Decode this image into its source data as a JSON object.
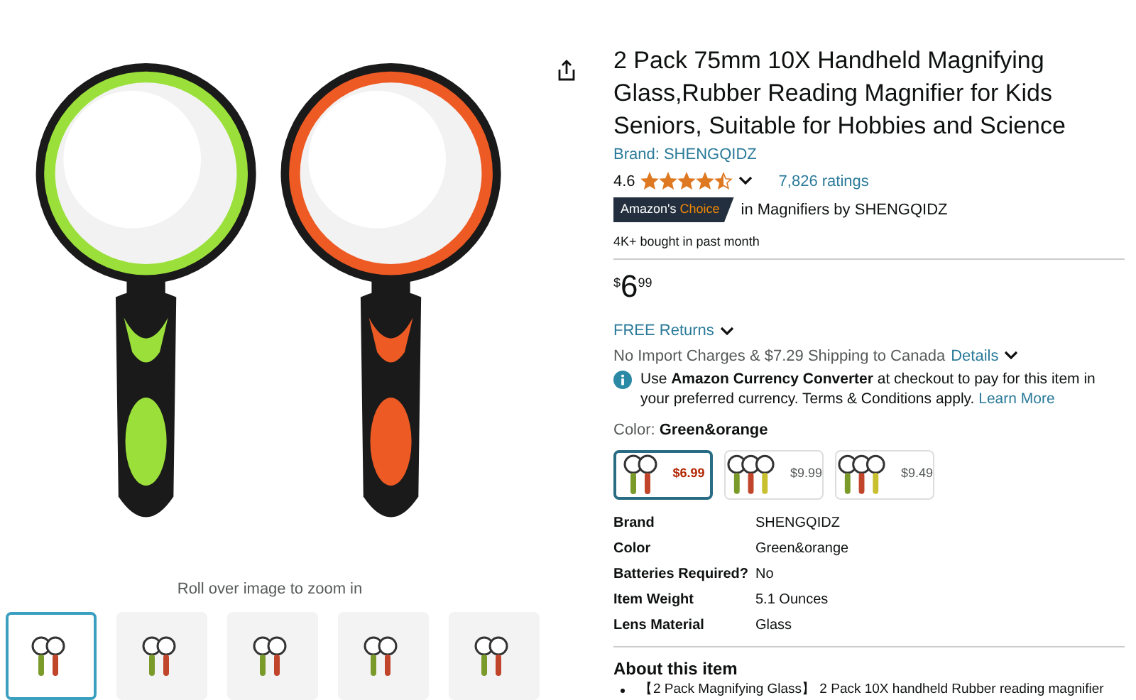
{
  "gallery": {
    "hint": "Roll over image to zoom in",
    "thumbnails": [
      {
        "selected": true
      },
      {
        "selected": false
      },
      {
        "selected": false
      },
      {
        "selected": false
      },
      {
        "selected": false
      }
    ]
  },
  "product": {
    "title": "2 Pack 75mm 10X Handheld Magnifying Glass,Rubber Reading Magnifier for Kids Seniors, Suitable for Hobbies and Science",
    "brand": "Brand: SHENGQIDZ",
    "rating": "4.6",
    "stars": 4.5,
    "ratings_count": "7,826 ratings",
    "badge": {
      "prefix": "Amazon's",
      "highlight": "Choice"
    },
    "badge_context": "in Magnifiers by SHENGQIDZ",
    "bought": "4K+ bought in past month"
  },
  "price": {
    "symbol": "$",
    "whole": "6",
    "fraction": "99"
  },
  "returns": "FREE Returns",
  "shipping": {
    "text": "No Import Charges & $7.29 Shipping to Canada",
    "link": "Details"
  },
  "notice": {
    "text": "Use **Amazon Currency Converter** at checkout to pay for this item in your preferred currency. Terms & Conditions apply.",
    "link": "Learn More"
  },
  "color": {
    "label": "Color:",
    "value": "Green&orange"
  },
  "variants": [
    {
      "price": "$6.99",
      "selected": true
    },
    {
      "price": "$9.99",
      "selected": false
    },
    {
      "price": "$9.49",
      "selected": false
    }
  ],
  "specs": [
    {
      "name": "Brand",
      "value": "SHENGQIDZ"
    },
    {
      "name": "Color",
      "value": "Green&orange"
    },
    {
      "name": "Batteries Required?",
      "value": "No"
    },
    {
      "name": "Item Weight",
      "value": "5.1 Ounces"
    },
    {
      "name": "Lens Material",
      "value": "Glass"
    }
  ],
  "about": {
    "heading": "About this item",
    "bullets": [
      "【2 Pack Magnifying Glass】 2 Pack 10X handheld Rubber reading magnifier"
    ]
  }
}
